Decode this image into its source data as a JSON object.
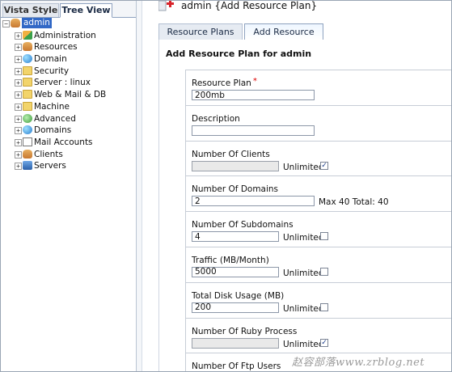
{
  "left_tabs": {
    "vista": "Vista Style",
    "tree": "Tree View"
  },
  "tree": {
    "root": "admin",
    "items": [
      {
        "label": "Administration",
        "icon": "admin-icon"
      },
      {
        "label": "Resources",
        "icon": "resources-icon"
      },
      {
        "label": "Domain",
        "icon": "globe-icon"
      },
      {
        "label": "Security",
        "icon": "folder-icon"
      },
      {
        "label": "Server : linux",
        "icon": "folder-icon"
      },
      {
        "label": "Web & Mail & DB",
        "icon": "folder-icon"
      },
      {
        "label": "Machine",
        "icon": "folder-icon"
      },
      {
        "label": "Advanced",
        "icon": "advanced-icon"
      },
      {
        "label": "Domains",
        "icon": "globe-icon"
      },
      {
        "label": "Mail Accounts",
        "icon": "mail-icon"
      },
      {
        "label": "Clients",
        "icon": "people-icon"
      },
      {
        "label": "Servers",
        "icon": "server-icon"
      }
    ]
  },
  "header": {
    "title": "admin {Add Resource Plan}"
  },
  "tabs": {
    "plans": "Resource Plans",
    "add": "Add Resource Plan"
  },
  "form": {
    "title": "Add Resource Plan for admin",
    "unlimited": "Unlimited",
    "required_mark": "*",
    "resource_plan": {
      "label": "Resource Plan",
      "value": "200mb"
    },
    "description": {
      "label": "Description",
      "value": ""
    },
    "clients": {
      "label": "Number Of Clients",
      "value": "",
      "unlimited": true
    },
    "domains": {
      "label": "Number Of Domains",
      "value": "2",
      "info": "Max 40  Total: 40"
    },
    "subdomains": {
      "label": "Number Of Subdomains",
      "value": "4",
      "unlimited": false
    },
    "traffic": {
      "label": "Traffic (MB/Month)",
      "value": "5000",
      "unlimited": false
    },
    "disk": {
      "label": "Total Disk Usage (MB)",
      "value": "200",
      "unlimited": false
    },
    "ruby": {
      "label": "Number Of Ruby Process",
      "value": "",
      "unlimited": true
    },
    "ftp": {
      "label": "Number Of Ftp Users"
    }
  },
  "watermark": "赵容部落www.zrblog.net",
  "colors": {
    "selection": "#3168c6",
    "tab_border": "#8ea2bf",
    "checkbox_mark": "#1a3c8a"
  }
}
